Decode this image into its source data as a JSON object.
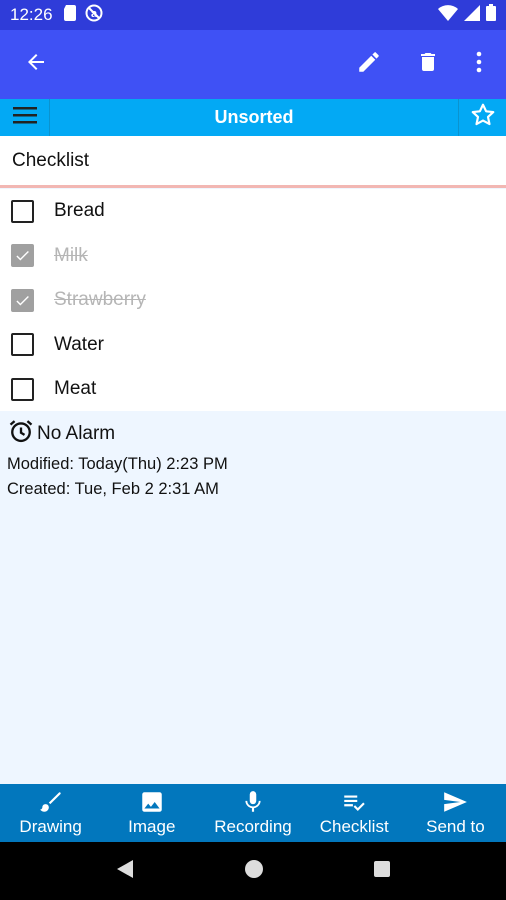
{
  "status_bar": {
    "time": "12:26",
    "left_icons": [
      "sd-card-icon",
      "no-disturb-icon"
    ],
    "right_icons": [
      "wifi-icon",
      "signal-icon",
      "battery-icon"
    ]
  },
  "app_bar": {
    "icons": [
      "back-arrow-icon",
      "edit-pencil-icon",
      "delete-trash-icon",
      "more-vert-icon"
    ]
  },
  "category_bar": {
    "title": "Unsorted"
  },
  "note": {
    "title": "Checklist",
    "items": [
      {
        "label": "Bread",
        "checked": false
      },
      {
        "label": "Milk",
        "checked": true
      },
      {
        "label": "Strawberry",
        "checked": true
      },
      {
        "label": "Water",
        "checked": false
      },
      {
        "label": "Meat",
        "checked": false
      }
    ]
  },
  "meta": {
    "alarm": "No Alarm",
    "modified": "Modified: Today(Thu) 2:23 PM",
    "created": "Created: Tue, Feb 2 2:31 AM"
  },
  "toolbar": {
    "items": [
      {
        "label": "Drawing",
        "icon": "brush-icon"
      },
      {
        "label": "Image",
        "icon": "image-icon"
      },
      {
        "label": "Recording",
        "icon": "microphone-icon"
      },
      {
        "label": "Checklist",
        "icon": "checklist-icon"
      },
      {
        "label": "Send to",
        "icon": "send-icon"
      }
    ]
  },
  "colors": {
    "status_bar": "#2f3cd9",
    "app_bar": "#3f51f5",
    "category_bar": "#03a9f4",
    "toolbar": "#0277bd",
    "meta_background": "#eef6ff"
  }
}
